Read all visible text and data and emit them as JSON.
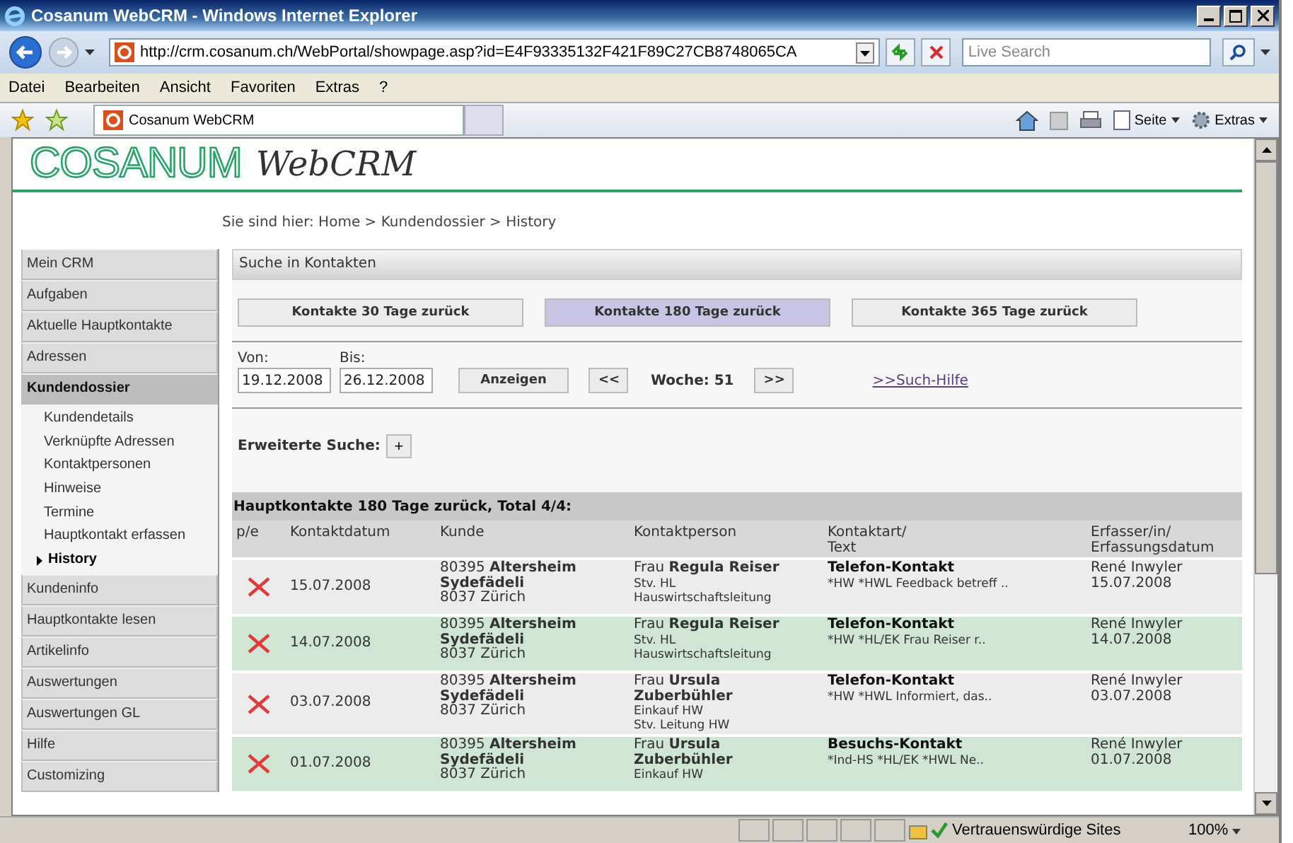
{
  "window": {
    "title": "Cosanum WebCRM - Windows Internet Explorer"
  },
  "address_bar": {
    "url": "http://crm.cosanum.ch/WebPortal/showpage.asp?id=E4F93335132F421F89C27CB8748065CA"
  },
  "search": {
    "placeholder": "Live Search"
  },
  "menu": [
    "Datei",
    "Bearbeiten",
    "Ansicht",
    "Favoriten",
    "Extras",
    "?"
  ],
  "favorites_bar": {
    "tab": "Cosanum WebCRM",
    "commands": [
      "Seite",
      "Extras"
    ]
  },
  "logo": {
    "brand": "COSANUM",
    "product": "WebCRM"
  },
  "breadcrumb": "Sie sind hier: Home > Kundendossier > History",
  "sidebar": {
    "items": [
      {
        "label": "Mein CRM",
        "selected": false
      },
      {
        "label": "Aufgaben",
        "selected": false
      },
      {
        "label": "Aktuelle Hauptkontakte",
        "selected": false
      },
      {
        "label": "Adressen",
        "selected": false
      },
      {
        "label": "Kundendossier",
        "selected": true,
        "children": [
          {
            "label": "Kundendetails",
            "selected": false
          },
          {
            "label": "Verknüpfte Adressen",
            "selected": false
          },
          {
            "label": "Kontaktpersonen",
            "selected": false
          },
          {
            "label": "Hinweise",
            "selected": false
          },
          {
            "label": "Termine",
            "selected": false
          },
          {
            "label": "Hauptkontakt erfassen",
            "selected": false
          },
          {
            "label": "History",
            "selected": true
          }
        ]
      },
      {
        "label": "Kundeninfo",
        "selected": false
      },
      {
        "label": "Hauptkontakte lesen",
        "selected": false
      },
      {
        "label": "Artikelinfo",
        "selected": false
      },
      {
        "label": "Auswertungen",
        "selected": false
      },
      {
        "label": "Auswertungen GL",
        "selected": false
      },
      {
        "label": "Hilfe",
        "selected": false
      },
      {
        "label": "Customizing",
        "selected": false
      }
    ]
  },
  "search_panel": {
    "title": "Suche in Kontakten",
    "ranges": [
      {
        "label": "Kontakte 30 Tage zurück",
        "selected": false
      },
      {
        "label": "Kontakte 180 Tage zurück",
        "selected": true
      },
      {
        "label": "Kontakte 365 Tage zurück",
        "selected": false
      }
    ],
    "from": {
      "label": "Von:",
      "value": "19.12.2008"
    },
    "to": {
      "label": "Bis:",
      "value": "26.12.2008"
    },
    "show_button": "Anzeigen",
    "prev_button": "<<",
    "week": "Woche: 51",
    "next_button": ">>",
    "help_link": ">>Such-Hilfe",
    "advanced": {
      "label": "Erweiterte Suche:",
      "button": "+"
    }
  },
  "table": {
    "title": "Hauptkontakte 180 Tage zurück, Total 4/4:",
    "columns": [
      "p/e",
      "Kontaktdatum",
      "Kunde",
      "Kontaktperson",
      "Kontaktart/\nText",
      "Erfasser/in/\nErfassungsdatum"
    ],
    "rows": [
      {
        "date": "15.07.2008",
        "customer": "80395 **Altersheim Sydefädeli**\n8037 Zürich",
        "person": "Frau **Regula Reiser**",
        "person_details": "Stv. HL\nHauswirtschaftsleitung",
        "type": "Telefon-Kontakt",
        "text": "*HW *HWL Feedback betreff ..",
        "author": "René Inwyler\n15.07.2008"
      },
      {
        "date": "14.07.2008",
        "customer": "80395 **Altersheim Sydefädeli**\n8037 Zürich",
        "person": "Frau **Regula Reiser**",
        "person_details": "Stv. HL\nHauswirtschaftsleitung",
        "type": "Telefon-Kontakt",
        "text": "*HW *HL/EK Frau Reiser r..",
        "author": "René Inwyler\n14.07.2008"
      },
      {
        "date": "03.07.2008",
        "customer": "80395 **Altersheim Sydefädeli**\n8037 Zürich",
        "person": "Frau **Ursula Zuberbühler**",
        "person_details": "Einkauf HW\nStv. Leitung HW",
        "type": "Telefon-Kontakt",
        "text": "*HW *HWL Informiert, das..",
        "author": "René Inwyler\n03.07.2008"
      },
      {
        "date": "01.07.2008",
        "customer": "80395 **Altersheim Sydefädeli**\n8037 Zürich",
        "person": "Frau **Ursula Zuberbühler**",
        "person_details": "Einkauf HW",
        "type": "Besuchs-Kontakt",
        "text": "*Ind-HS *HL/EK *HWL Ne..",
        "author": "René Inwyler\n01.07.2008"
      }
    ]
  },
  "status_bar": {
    "zone": "Vertrauenswürdige Sites",
    "zoom": "100%"
  }
}
